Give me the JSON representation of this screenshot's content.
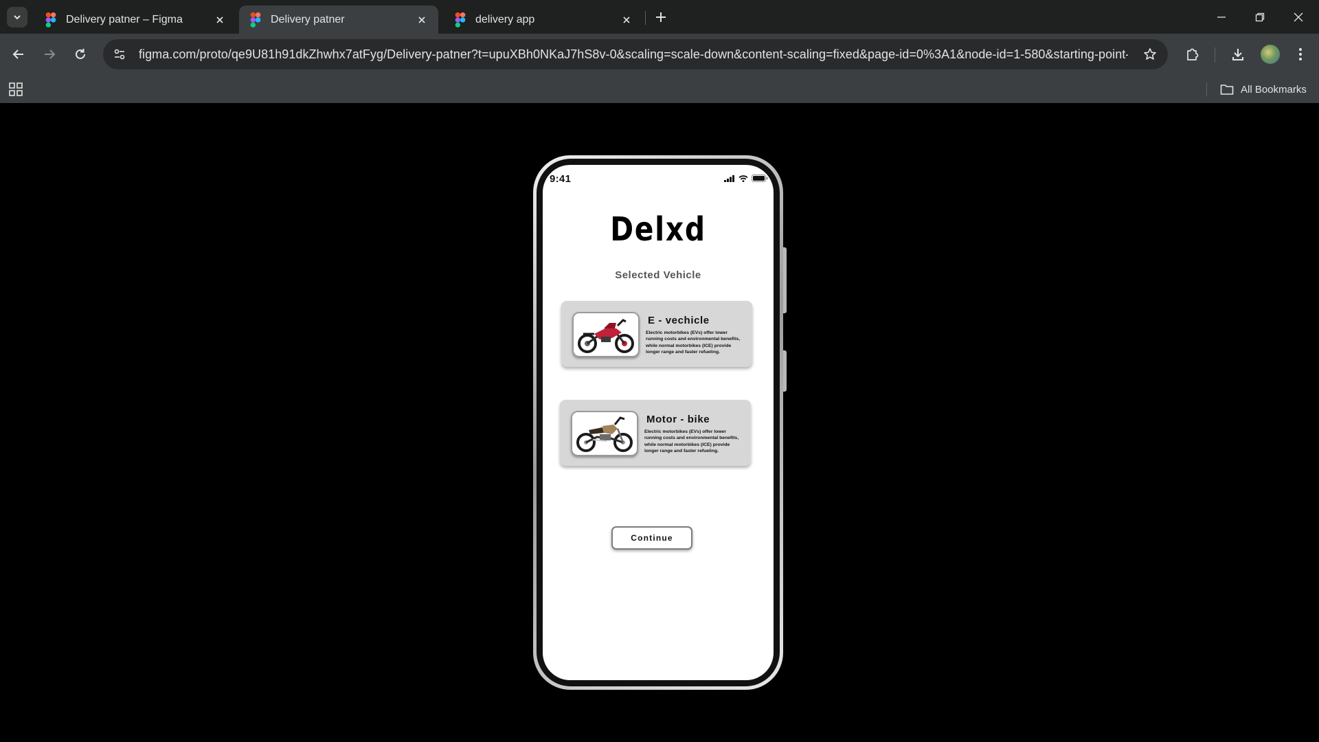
{
  "browser": {
    "tabs": [
      {
        "label": "Delivery patner – Figma",
        "active": false
      },
      {
        "label": "Delivery patner",
        "active": true
      },
      {
        "label": "delivery app",
        "active": false
      }
    ],
    "url": "figma.com/proto/qe9U81h91dkZhwhx7atFyg/Delivery-patner?t=upuXBh0NKaJ7hS8v-0&scaling=scale-down&content-scaling=fixed&page-id=0%3A1&node-id=1-580&starting-point-n...",
    "bookmarks_label": "All Bookmarks",
    "accent_color": "#3c3f41"
  },
  "phone": {
    "status_time": "9:41",
    "brand": "Delxd",
    "subtitle": "Selected Vehicle",
    "vehicles": [
      {
        "title": "E - vechicle",
        "description": "Electric motorbikes (EVs) offer lower running costs and environmental benefits, while normal motorbikes (ICE) provide longer range and faster refueling.",
        "image": "red-electric-motorbike",
        "color": "#c2213a"
      },
      {
        "title": "Motor - bike",
        "description": "Electric motorbikes (EVs) offer lower running costs and environmental benefits, while normal motorbikes (ICE) provide longer range and faster refueling.",
        "image": "bronze-motorbike",
        "color": "#a4825a"
      }
    ],
    "continue_label": "Continue"
  }
}
